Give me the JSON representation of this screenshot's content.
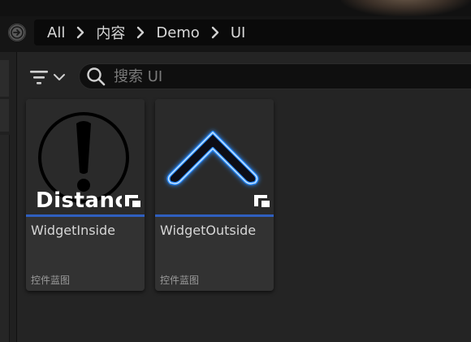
{
  "breadcrumb": {
    "items": [
      "All",
      "内容",
      "Demo",
      "UI"
    ]
  },
  "search": {
    "placeholder": "搜索 UI",
    "value": ""
  },
  "assets": [
    {
      "name": "WidgetInside",
      "type": "控件蓝图",
      "thumbnail_icon": "exclamation-circle-icon",
      "thumbnail_text": "Distance"
    },
    {
      "name": "WidgetOutside",
      "type": "控件蓝图",
      "thumbnail_icon": "glowing-chevron-up-icon"
    }
  ],
  "colors": {
    "accent_bar": "#2f5fbf",
    "glow_blue": "#2a8cff"
  }
}
